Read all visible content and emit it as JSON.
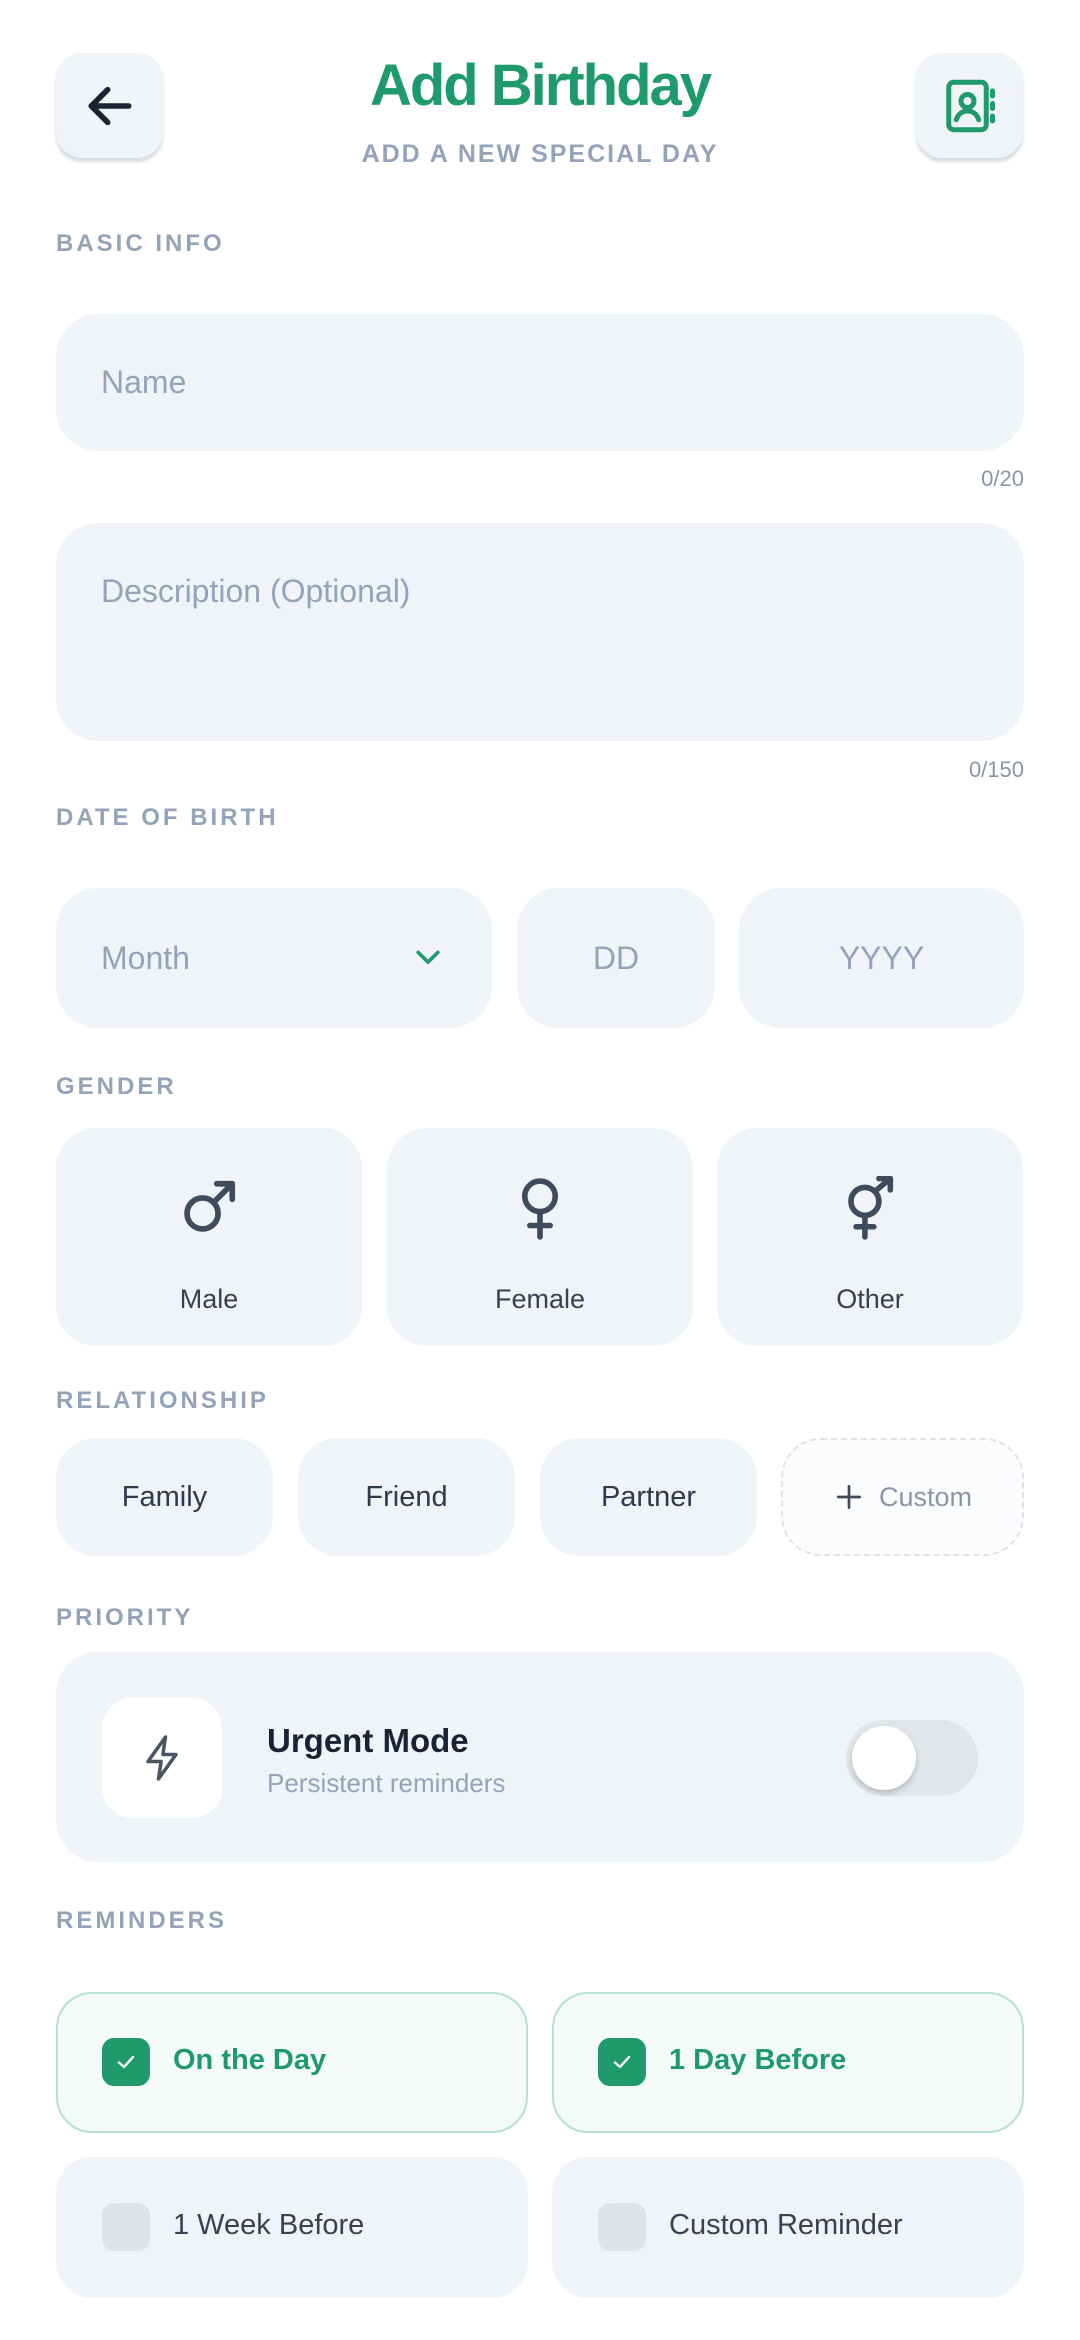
{
  "header": {
    "title": "Add Birthday",
    "subtitle": "ADD A NEW SPECIAL DAY",
    "back_icon": "arrow-left-icon",
    "contacts_icon": "contact-book-icon"
  },
  "basic_info": {
    "section_label": "BASIC INFO",
    "name_placeholder": "Name",
    "name_counter": "0/20",
    "description_placeholder": "Description (Optional)",
    "description_counter": "0/150"
  },
  "date_of_birth": {
    "section_label": "DATE OF BIRTH",
    "month_placeholder": "Month",
    "day_placeholder": "DD",
    "year_placeholder": "YYYY"
  },
  "gender": {
    "section_label": "GENDER",
    "options": [
      {
        "label": "Male",
        "icon": "male-symbol-icon"
      },
      {
        "label": "Female",
        "icon": "female-symbol-icon"
      },
      {
        "label": "Other",
        "icon": "transgender-symbol-icon"
      }
    ]
  },
  "relationship": {
    "section_label": "RELATIONSHIP",
    "options": [
      "Family",
      "Friend",
      "Partner"
    ],
    "custom_label": "Custom"
  },
  "priority": {
    "section_label": "PRIORITY",
    "title": "Urgent Mode",
    "subtitle": "Persistent reminders",
    "enabled": false
  },
  "reminders": {
    "section_label": "REMINDERS",
    "options": [
      {
        "label": "On the Day",
        "checked": true
      },
      {
        "label": "1 Day Before",
        "checked": true
      },
      {
        "label": "1 Week Before",
        "checked": false
      },
      {
        "label": "Custom Reminder",
        "checked": false
      }
    ]
  },
  "colors": {
    "accent": "#1e9a6c",
    "field_bg": "#f0f3f8",
    "muted_text": "#94a3b8"
  }
}
